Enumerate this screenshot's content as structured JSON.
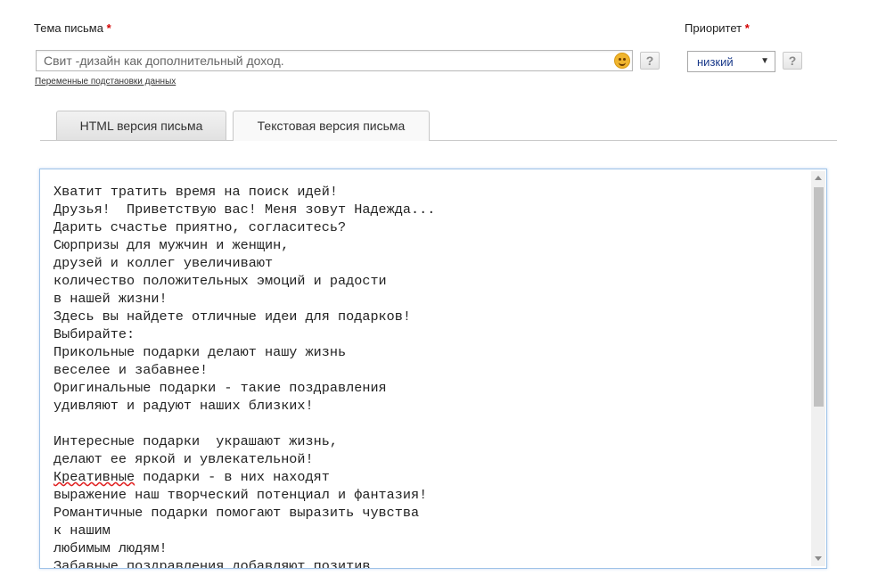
{
  "subject": {
    "label": "Тема письма",
    "required_mark": "*",
    "value": "Свит -дизайн как дополнительный доход.",
    "help": "?",
    "variables_link": "Переменные подстановки данных"
  },
  "priority": {
    "label": "Приоритет",
    "required_mark": "*",
    "selected": "низкий",
    "help": "?"
  },
  "tabs": [
    {
      "label": "HTML версия письма",
      "active": false
    },
    {
      "label": "Текстовая версия письма",
      "active": true
    }
  ],
  "editor": {
    "lines": [
      "Хватит тратить время на поиск идей!",
      "Друзья!  Приветствую вас! Меня зовут Надежда...",
      "Дарить счастье приятно, согласитесь?",
      "Сюрпризы для мужчин и женщин,",
      "друзей и коллег увеличивают",
      "количество положительных эмоций и радости",
      "в нашей жизни!",
      "Здесь вы найдете отличные идеи для подарков!",
      "Выбирайте:",
      "Прикольные подарки делают нашу жизнь",
      "веселее и забавнее!",
      "Оригинальные подарки - такие поздравления",
      "удивляют и радуют наших близких!",
      "",
      "Интересные подарки  украшают жизнь,",
      "делают ее яркой и увлекательной!",
      "Креативные подарки - в них находят",
      "выражение наш творческий потенциал и фантазия!",
      "Романтичные подарки помогают выразить чувства",
      "к нашим",
      "любимым людям!",
      "Забавные поздравления добавляют позитив"
    ],
    "spellcheck_word": "Креативные"
  },
  "icons": {
    "emoji": "smiley-icon",
    "scroll_up": "scroll-up-arrow-icon",
    "scroll_down": "scroll-down-arrow-icon",
    "dropdown": "chevron-down-icon"
  },
  "colors": {
    "required": "#d40000",
    "editor_border": "#9fc3e8",
    "select_text": "#1a3a8a"
  }
}
